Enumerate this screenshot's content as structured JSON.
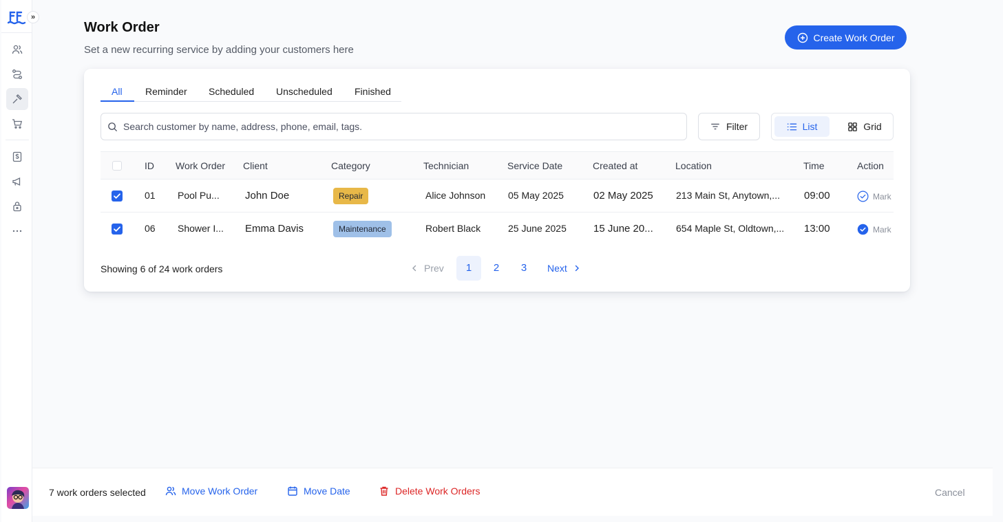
{
  "header": {
    "title": "Work Order",
    "subtitle": "Set a new recurring service by adding your customers here",
    "create_label": "Create Work Order"
  },
  "sidebar": {
    "expand_label": "»",
    "icons": [
      "users-icon",
      "routes-icon",
      "tools-icon",
      "cart-icon",
      "invoice-icon",
      "megaphone-icon",
      "lock-icon",
      "more-icon"
    ]
  },
  "tabs": [
    {
      "label": "All",
      "active": true
    },
    {
      "label": "Reminder"
    },
    {
      "label": "Scheduled"
    },
    {
      "label": "Unscheduled"
    },
    {
      "label": "Finished"
    }
  ],
  "search": {
    "placeholder": "Search customer by name, address, phone, email, tags."
  },
  "toolbar": {
    "filter_label": "Filter",
    "list_label": "List",
    "grid_label": "Grid"
  },
  "table": {
    "columns": [
      "ID",
      "Work Order",
      "Client",
      "Category",
      "Technician",
      "Service Date",
      "Created at",
      "Location",
      "Time",
      "Action"
    ],
    "rows": [
      {
        "checked": true,
        "id": "01",
        "work_order": "Pool Pu...",
        "client": "John Doe",
        "category": "Repair",
        "technician": "Alice Johnson",
        "service_date": "05 May 2025",
        "created_at": "02 May 2025",
        "location": "213 Main St, Anytown,...",
        "time": "09:00",
        "action": "Mark"
      },
      {
        "checked": true,
        "id": "06",
        "work_order": "Shower I...",
        "client": "Emma Davis",
        "category": "Maintenance",
        "technician": "Robert Black",
        "service_date": "25 June 2025",
        "created_at": "15 June 20...",
        "location": "654 Maple St, Oldtown,...",
        "time": "13:00",
        "action": "Mark"
      }
    ]
  },
  "footer": {
    "showing": "Showing 6 of 24 work orders",
    "prev": "Prev",
    "pages": [
      "1",
      "2",
      "3"
    ],
    "current_page": "1",
    "next": "Next"
  },
  "bottom_bar": {
    "selected_text": "7 work orders selected",
    "move_work_order": "Move Work Order",
    "move_date": "Move Date",
    "delete": "Delete Work Orders",
    "cancel": "Cancel"
  },
  "colors": {
    "accent": "#2563eb",
    "repair": "#e8b848",
    "maintenance": "#9fc0e8",
    "danger": "#dc2626"
  }
}
